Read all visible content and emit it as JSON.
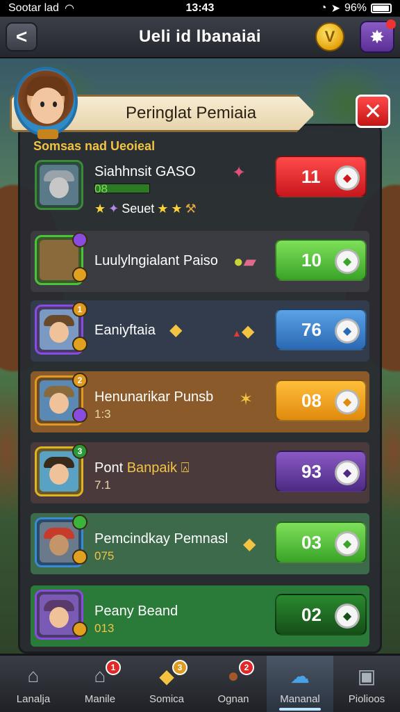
{
  "status_bar": {
    "carrier": "Sootar lad",
    "time": "13:43",
    "battery": "96%",
    "battery_level": 0.96
  },
  "header": {
    "back_label": "<",
    "title": "Ueli id lbanaiai",
    "coin_icon": "coin-icon",
    "settings_icon": "gear-icon"
  },
  "panel": {
    "banner_title": "Peringlat Pemiaia",
    "close_label": "✕",
    "section_label": "Somsas nad Ueoieal"
  },
  "rows": [
    {
      "name": "Siahhnsit GASO",
      "sub": "08",
      "extra": "Seuet",
      "value": "11",
      "color": "#e0202a",
      "bg": "transparent",
      "frame": "#3a8a3a",
      "badge": ""
    },
    {
      "name": "Luulylngialant Paiso",
      "sub": "",
      "extra": "",
      "value": "10",
      "color": "#58c63a",
      "bg": "#3a3c42",
      "frame": "#4cc23a",
      "badge": "#8a4be0"
    },
    {
      "name": "Eaniyftaia",
      "sub": "",
      "extra": "",
      "value": "76",
      "color": "#3a82d4",
      "bg": "#323c4c",
      "frame": "#8a4be0",
      "badge": "#e09a20"
    },
    {
      "name": "Henunarikar Punsb",
      "sub": "1:3",
      "extra": "",
      "value": "08",
      "color": "#f5a31a",
      "bg": "#8a5a2a",
      "frame": "#e09a20",
      "badge": "#e09a20"
    },
    {
      "name": "Pont",
      "name2": "Banpaik",
      "sub": "7.1",
      "extra": "",
      "value": "93",
      "color": "#6a3aa6",
      "bg": "#4a3a3c",
      "frame": "#e0b420",
      "badge": "#2a9a3a"
    },
    {
      "name": "Pemcindkay Pemnasl",
      "sub": "075",
      "extra": "",
      "value": "03",
      "color": "#58c63a",
      "bg": "#3c6a4a",
      "frame": "#3a8ad4",
      "badge": "#3ab43a"
    },
    {
      "name": "Peany Beand",
      "sub": "013",
      "extra": "",
      "value": "02",
      "color": "#1c6a24",
      "bg": "#2a7a3a",
      "frame": "#8a4be0",
      "badge": ""
    }
  ],
  "bottom_tabs": [
    {
      "label": "Lanalja",
      "icon": "home-icon",
      "badge": ""
    },
    {
      "label": "Manile",
      "icon": "house-icon",
      "badge": "1"
    },
    {
      "label": "Somica",
      "icon": "gift-icon",
      "badge": "3"
    },
    {
      "label": "Ognan",
      "icon": "ball-icon",
      "badge": "2"
    },
    {
      "label": "Mananal",
      "icon": "chat-icon",
      "badge": ""
    },
    {
      "label": "Piolioos",
      "icon": "photos-icon",
      "badge": ""
    }
  ],
  "colors": {
    "accent": "#f3c442",
    "panel": "#282a30",
    "banner": "#f1e4c4"
  }
}
